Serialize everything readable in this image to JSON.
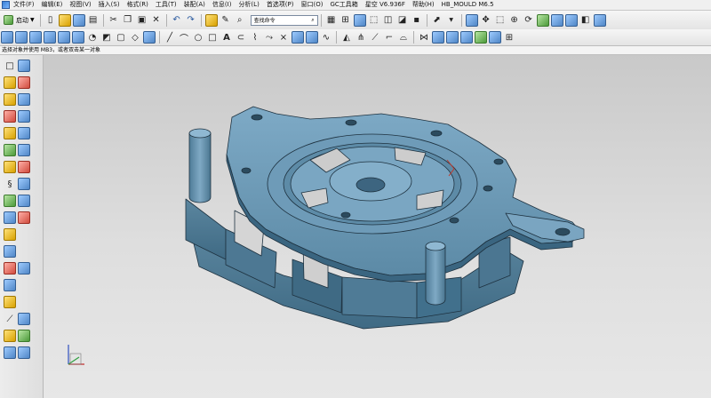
{
  "menubar": {
    "items": [
      "文件(F)",
      "编辑(E)",
      "视图(V)",
      "插入(S)",
      "格式(R)",
      "工具(T)",
      "装配(A)",
      "信息(I)",
      "分析(L)",
      "首选项(P)",
      "窗口(O)",
      "GC工具箱",
      "星空 V6.936F",
      "帮助(H)",
      "HB_MOULD M6.5"
    ]
  },
  "toolbar": {
    "start_label": "启动",
    "command_finder_placeholder": "查找命令"
  },
  "status": {
    "prompt": "选择对象并使用 MB3，或者双击某一对象"
  },
  "colors": {
    "part_face": "#5f8da9",
    "part_edge": "#1e3240",
    "viewport_top": "#c9c9c9",
    "viewport_bottom": "#e7e7e7"
  }
}
